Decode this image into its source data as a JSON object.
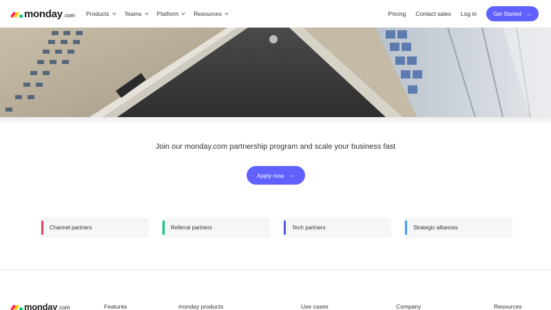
{
  "header": {
    "logo_text": "monday",
    "logo_suffix": ".com",
    "nav": [
      {
        "label": "Products"
      },
      {
        "label": "Teams"
      },
      {
        "label": "Platform"
      },
      {
        "label": "Resources"
      }
    ],
    "pricing": "Pricing",
    "contact_sales": "Contact sales",
    "login": "Log in",
    "get_started": "Get Started",
    "arrow_icon": "arrow-right-icon"
  },
  "hero": {
    "image": "building-facade-photo"
  },
  "main": {
    "tagline": "Join our monday.com partnership program and scale your business fast",
    "apply_label": "Apply now"
  },
  "partners": [
    {
      "label": "Channel partners",
      "color": "#e2445c"
    },
    {
      "label": "Referral partners",
      "color": "#00c875"
    },
    {
      "label": "Tech partners",
      "color": "#5559df"
    },
    {
      "label": "Strategic alliances",
      "color": "#3d9cff"
    }
  ],
  "footer": {
    "logo_text": "monday",
    "logo_suffix": ".com",
    "columns": [
      "Features",
      "monday products",
      "Use cases",
      "Company",
      "Resources"
    ]
  },
  "colors": {
    "brand": "#6161ff",
    "text": "#323338"
  }
}
